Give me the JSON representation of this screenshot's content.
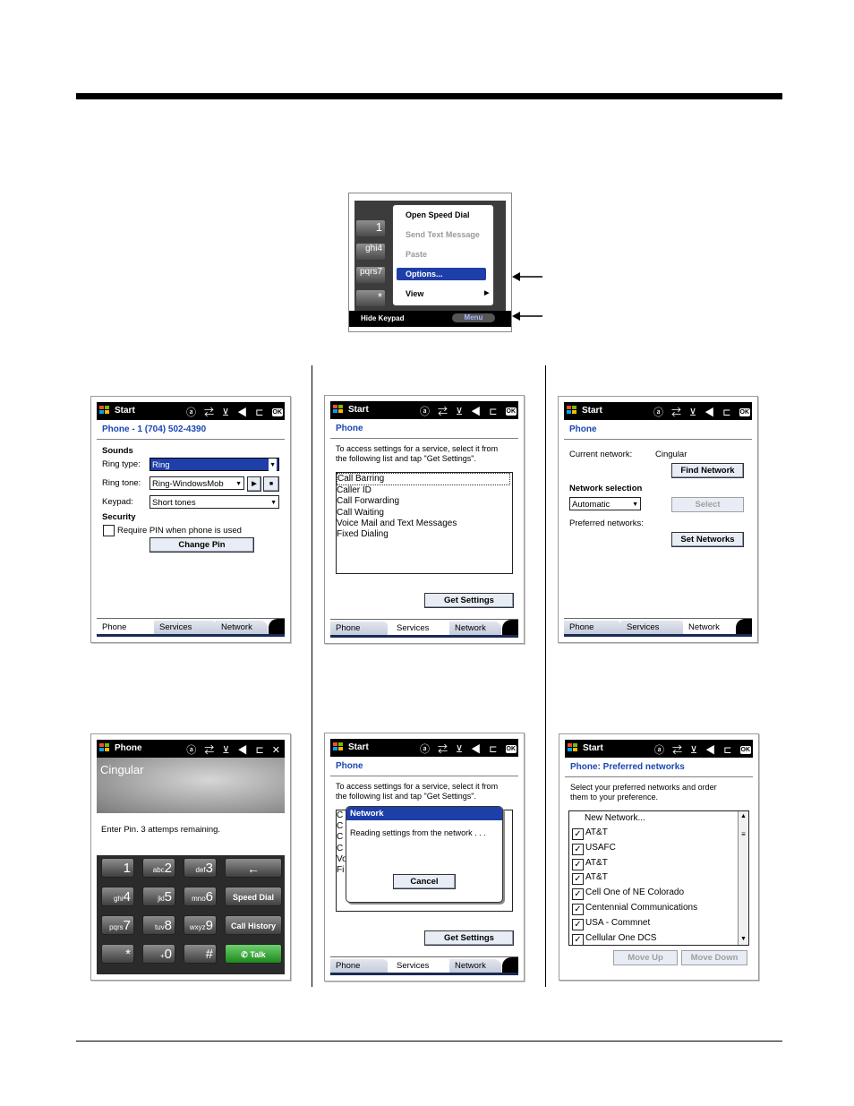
{
  "menu_screenshot": {
    "keys": [
      "1",
      "ghi4",
      "pqrs7",
      "*"
    ],
    "items": [
      "Open Speed Dial",
      "Send Text Message",
      "Paste",
      "Options...",
      "View"
    ],
    "soft_left": "Hide Keypad",
    "soft_right": "Menu"
  },
  "status_bar": {
    "start": "Start",
    "phone": "Phone",
    "icons": "ⓐ ⇄ ⊻ ◀ ⊏",
    "ok": "OK"
  },
  "tabs": {
    "phone": "Phone",
    "services": "Services",
    "network": "Network"
  },
  "screen_phone": {
    "title": "Phone - 1 (704) 502-4390",
    "sounds": "Sounds",
    "ring_type_label": "Ring type:",
    "ring_type_value": "Ring",
    "ring_tone_label": "Ring tone:",
    "ring_tone_value": "Ring-WindowsMob",
    "keypad_label": "Keypad:",
    "keypad_value": "Short tones",
    "security": "Security",
    "require_pin": "Require PIN when phone is used",
    "change_pin": "Change Pin"
  },
  "screen_services": {
    "title": "Phone",
    "instructions_1": "To access settings for a service, select it from",
    "instructions_2": "the following list and tap \"Get Settings\".",
    "items": [
      "Call Barring",
      "Caller ID",
      "Call Forwarding",
      "Call Waiting",
      "Voice Mail and Text Messages",
      "Fixed Dialing"
    ],
    "get_settings": "Get Settings"
  },
  "screen_network": {
    "title": "Phone",
    "current_network_label": "Current network:",
    "current_network_value": "Cingular",
    "find_network": "Find Network",
    "network_selection": "Network selection",
    "selection_value": "Automatic",
    "select": "Select",
    "preferred_networks": "Preferred networks:",
    "set_networks": "Set Networks"
  },
  "screen_pin": {
    "carrier": "Cingular",
    "prompt": "Enter Pin. 3 attemps remaining.",
    "keys": [
      {
        "main": "1",
        "sub": ""
      },
      {
        "main": "2",
        "sub": "abc"
      },
      {
        "main": "3",
        "sub": "def"
      },
      {
        "main": "4",
        "sub": "ghi"
      },
      {
        "main": "5",
        "sub": "jkl"
      },
      {
        "main": "6",
        "sub": "mno"
      },
      {
        "main": "7",
        "sub": "pqrs"
      },
      {
        "main": "8",
        "sub": "tuv"
      },
      {
        "main": "9",
        "sub": "wxyz"
      },
      {
        "main": "*",
        "sub": ""
      },
      {
        "main": "0",
        "sub": "+"
      },
      {
        "main": "#",
        "sub": ""
      }
    ],
    "backspace": "←",
    "speed_dial": "Speed Dial",
    "call_history": "Call History",
    "talk": "Talk"
  },
  "screen_reading": {
    "dialog_title": "Network",
    "dialog_text": "Reading settings from the network . . .",
    "cancel": "Cancel",
    "partial_items": [
      "C",
      "C",
      "C",
      "C",
      "Vo",
      "Fi"
    ]
  },
  "screen_preferred": {
    "title": "Phone: Preferred networks",
    "instructions_1": "Select your preferred networks and order",
    "instructions_2": "them to your preference.",
    "new_network": "New Network...",
    "networks": [
      "AT&T",
      "USAFC",
      "AT&T",
      "AT&T",
      "Cell One of NE Colorado",
      "Centennial Communications",
      "USA - Commnet",
      "Cellular One DCS"
    ],
    "move_up": "Move Up",
    "move_down": "Move Down"
  }
}
